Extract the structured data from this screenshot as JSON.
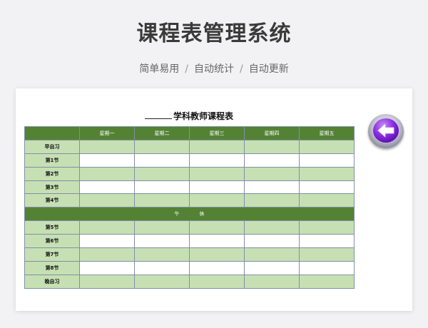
{
  "header": {
    "title": "课程表管理系统",
    "subtitle_items": [
      "简单易用",
      "自动统计",
      "自动更新"
    ],
    "separator": "/"
  },
  "schedule": {
    "title": "学科教师课程表",
    "columns": [
      "",
      "星期一",
      "星期二",
      "星期三",
      "星期四",
      "星期五"
    ],
    "rows_before_lunch": [
      "早自习",
      "第1节",
      "第2节",
      "第3节",
      "第4节"
    ],
    "lunch": [
      "午",
      "休"
    ],
    "rows_after_lunch": [
      "第5节",
      "第6节",
      "第7节",
      "第8节",
      "晚自习"
    ]
  },
  "back_button": {
    "icon": "arrow-left-icon",
    "color": "#7b1fd6"
  },
  "colors": {
    "header_green": "#548235",
    "light_green": "#c6e0b4",
    "background": "#f2f2f4"
  }
}
